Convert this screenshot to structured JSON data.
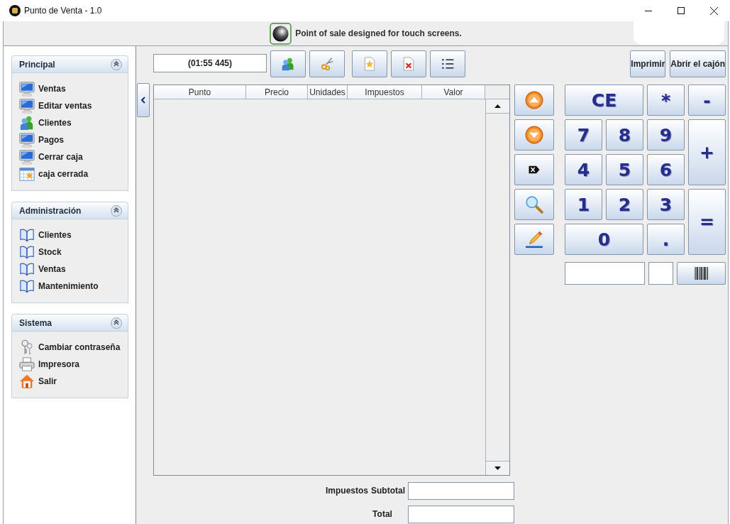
{
  "window": {
    "title": "Punto de Venta - 1.0"
  },
  "header": {
    "text": "Point of sale designed for touch screens."
  },
  "sidebar": [
    {
      "title": "Principal",
      "expanded": true,
      "items": [
        {
          "label": "Ventas",
          "kind": "monitor"
        },
        {
          "label": "Editar ventas",
          "kind": "monitor"
        },
        {
          "label": "Clientes",
          "kind": "people"
        },
        {
          "label": "Pagos",
          "kind": "monitor"
        },
        {
          "label": "Cerrar caja",
          "kind": "monitor"
        },
        {
          "label": "caja cerrada",
          "kind": "calendar"
        }
      ]
    },
    {
      "title": "Administración",
      "expanded": true,
      "items": [
        {
          "label": "Clientes",
          "kind": "book"
        },
        {
          "label": "Stock",
          "kind": "book"
        },
        {
          "label": "Ventas",
          "kind": "book"
        },
        {
          "label": "Mantenimiento",
          "kind": "book"
        }
      ]
    },
    {
      "title": "Sistema",
      "expanded": true,
      "items": [
        {
          "label": "Cambiar contraseña",
          "kind": "keys"
        },
        {
          "label": "Impresora",
          "kind": "printer"
        },
        {
          "label": "Salir",
          "kind": "house"
        }
      ]
    }
  ],
  "toolbar": {
    "timer": "(01:55 445)",
    "buttons": [
      {
        "kind": "people"
      },
      {
        "kind": "scissors"
      },
      {
        "kind": "new-doc"
      },
      {
        "kind": "delete-doc"
      },
      {
        "kind": "list"
      }
    ]
  },
  "actions": [
    {
      "label": "Imprimir"
    },
    {
      "label": "Abrir el cajón"
    }
  ],
  "ticket": {
    "columns": [
      "Punto",
      "Precio",
      "Unidades",
      "Impuestos",
      "Valor"
    ]
  },
  "side_buttons": [
    {
      "kind": "up"
    },
    {
      "kind": "down"
    },
    {
      "kind": "clear"
    },
    {
      "kind": "search"
    },
    {
      "kind": "edit"
    }
  ],
  "keypad": {
    "keys": [
      "CE",
      "*",
      "-",
      "7",
      "8",
      "9",
      "+",
      "4",
      "5",
      "6",
      "1",
      "2",
      "3",
      "=",
      "0",
      "."
    ]
  },
  "totals": {
    "tax_label": "Impuestos",
    "subtotal_label": "Subtotal",
    "total_label": "Total"
  }
}
